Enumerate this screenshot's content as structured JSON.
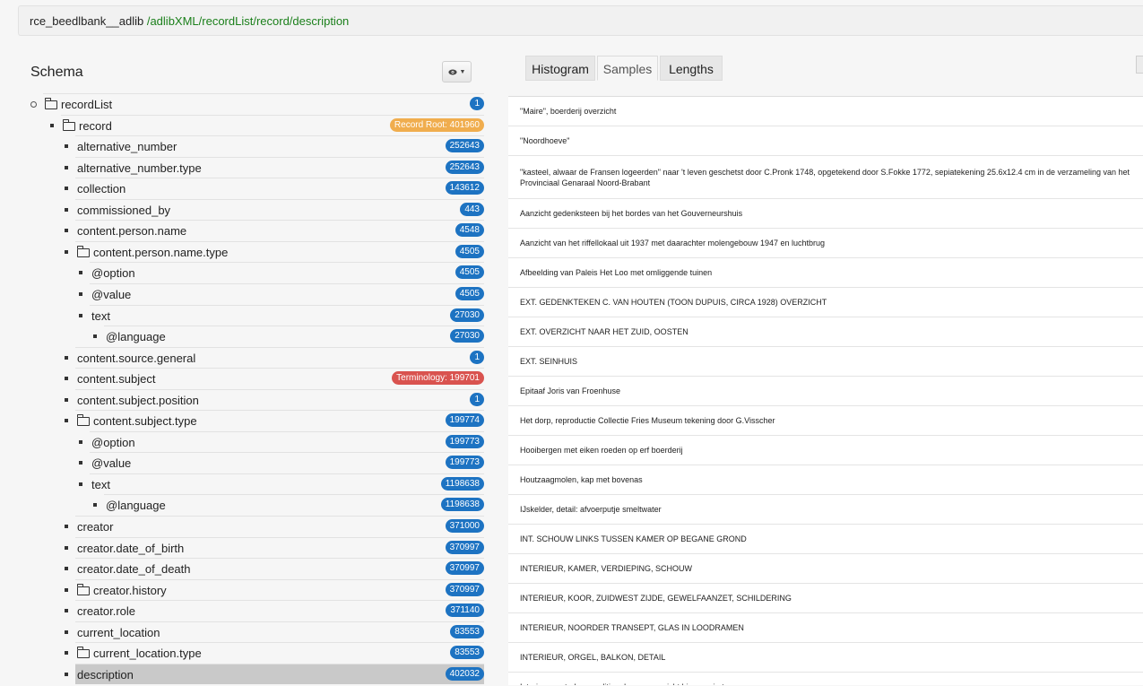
{
  "path": {
    "database": "rce_beedlbank__adlib",
    "xpath": "/adlibXML/recordList/record/description"
  },
  "schema": {
    "title": "Schema",
    "view_toggle_icon": "eye-icon"
  },
  "tree": [
    {
      "label": "recordList",
      "folder": true,
      "count": "1",
      "badge": "primary",
      "bullet": "open"
    },
    {
      "label": "record",
      "folder": true,
      "count": "Record Root: 401960",
      "badge": "warning",
      "bullet": "square"
    },
    {
      "label": "alternative_number",
      "folder": false,
      "count": "252643",
      "badge": "primary",
      "bullet": "square"
    },
    {
      "label": "alternative_number.type",
      "folder": false,
      "count": "252643",
      "badge": "primary",
      "bullet": "square"
    },
    {
      "label": "collection",
      "folder": false,
      "count": "143612",
      "badge": "primary",
      "bullet": "square"
    },
    {
      "label": "commissioned_by",
      "folder": false,
      "count": "443",
      "badge": "primary",
      "bullet": "square"
    },
    {
      "label": "content.person.name",
      "folder": false,
      "count": "4548",
      "badge": "primary",
      "bullet": "square"
    },
    {
      "label": "content.person.name.type",
      "folder": true,
      "count": "4505",
      "badge": "primary",
      "bullet": "square"
    },
    {
      "label": "@option",
      "folder": false,
      "count": "4505",
      "badge": "primary",
      "bullet": "square"
    },
    {
      "label": "@value",
      "folder": false,
      "count": "4505",
      "badge": "primary",
      "bullet": "square"
    },
    {
      "label": "text",
      "folder": false,
      "count": "27030",
      "badge": "primary",
      "bullet": "square"
    },
    {
      "label": "@language",
      "folder": false,
      "count": "27030",
      "badge": "primary",
      "bullet": "square"
    },
    {
      "label": "content.source.general",
      "folder": false,
      "count": "1",
      "badge": "primary",
      "bullet": "square"
    },
    {
      "label": "content.subject",
      "folder": false,
      "count": "Terminology: 199701",
      "badge": "danger",
      "bullet": "square"
    },
    {
      "label": "content.subject.position",
      "folder": false,
      "count": "1",
      "badge": "primary",
      "bullet": "square"
    },
    {
      "label": "content.subject.type",
      "folder": true,
      "count": "199774",
      "badge": "primary",
      "bullet": "square"
    },
    {
      "label": "@option",
      "folder": false,
      "count": "199773",
      "badge": "primary",
      "bullet": "square"
    },
    {
      "label": "@value",
      "folder": false,
      "count": "199773",
      "badge": "primary",
      "bullet": "square"
    },
    {
      "label": "text",
      "folder": false,
      "count": "1198638",
      "badge": "primary",
      "bullet": "square"
    },
    {
      "label": "@language",
      "folder": false,
      "count": "1198638",
      "badge": "primary",
      "bullet": "square"
    },
    {
      "label": "creator",
      "folder": false,
      "count": "371000",
      "badge": "primary",
      "bullet": "square"
    },
    {
      "label": "creator.date_of_birth",
      "folder": false,
      "count": "370997",
      "badge": "primary",
      "bullet": "square"
    },
    {
      "label": "creator.date_of_death",
      "folder": false,
      "count": "370997",
      "badge": "primary",
      "bullet": "square"
    },
    {
      "label": "creator.history",
      "folder": true,
      "count": "370997",
      "badge": "primary",
      "bullet": "square"
    },
    {
      "label": "creator.role",
      "folder": false,
      "count": "371140",
      "badge": "primary",
      "bullet": "square"
    },
    {
      "label": "current_location",
      "folder": false,
      "count": "83553",
      "badge": "primary",
      "bullet": "square"
    },
    {
      "label": "current_location.type",
      "folder": true,
      "count": "83553",
      "badge": "primary",
      "bullet": "square"
    },
    {
      "label": "description",
      "folder": false,
      "count": "402032",
      "badge": "primary",
      "bullet": "square",
      "selected": true
    }
  ],
  "tabs": [
    {
      "label": "Histogram",
      "active": false
    },
    {
      "label": "Samples",
      "active": true
    },
    {
      "label": "Lengths",
      "active": false
    }
  ],
  "samples": [
    "\"Maire\", boerderij overzicht",
    "\"Noordhoeve\"",
    "\"kasteel, alwaar de Fransen logeerden\" naar 't leven geschetst door C.Pronk 1748, opgetekend door S.Fokke 1772, sepiatekening 25.6x12.4 cm in de verzameling van het Provinciaal Genaraal Noord-Brabant",
    "Aanzicht gedenksteen bij het bordes van het Gouverneurshuis",
    "Aanzicht van het riffellokaal uit 1937 met daarachter molengebouw 1947 en luchtbrug",
    "Afbeelding van Paleis Het Loo met omliggende tuinen",
    "EXT. GEDENKTEKEN C. VAN HOUTEN (TOON DUPUIS, CIRCA 1928) OVERZICHT",
    "EXT. OVERZICHT NAAR HET ZUID, OOSTEN",
    "EXT. SEINHUIS",
    "Epitaaf Joris van Froenhuse",
    "Het dorp, reproductie Collectie Fries Museum tekening door G.Visscher",
    "Hooibergen met eiken roeden op erf boerderij",
    "Houtzaagmolen, kap met bovenas",
    "IJskelder, detail: afvoerputje smeltwater",
    "INT. SCHOUW LINKS TUSSEN KAMER OP BEGANE GROND",
    "INTERIEUR, KAMER, VERDIEPING, SCHOUW",
    "INTERIEUR, KOOR, ZUIDWEST ZIJDE, GEWELFAANZET, SCHILDERING",
    "INTERIEUR, NOORDER TRANSEPT, GLAS IN LOODRAMEN",
    "INTERIEUR, ORGEL, BALKON, DETAIL",
    "Interieur centrale expeditiegebouw, overzicht binnenruimte"
  ]
}
